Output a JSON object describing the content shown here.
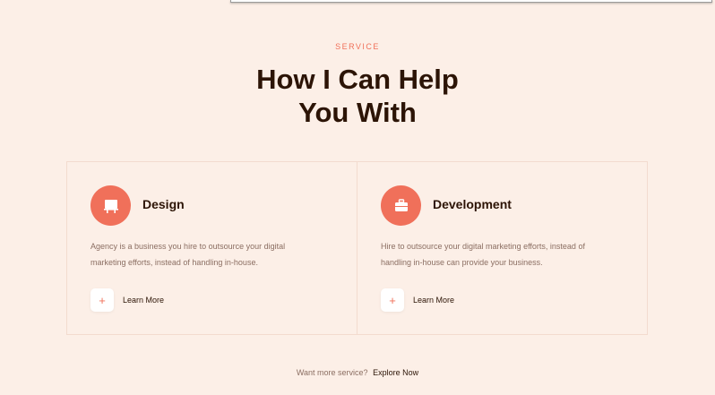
{
  "section": {
    "eyebrow": "SERVICE",
    "heading_line1": "How I Can Help",
    "heading_line2": "You With"
  },
  "services": [
    {
      "icon": "easel-icon",
      "title": "Design",
      "description_line1": "Agency is a business you hire to outsource your digital",
      "description_line2": "marketing efforts, instead of handling in-house.",
      "button_label": "Learn More"
    },
    {
      "icon": "briefcase-icon",
      "title": "Development",
      "description_line1": "Hire to outsource your digital marketing efforts, instead of",
      "description_line2": "handling in-house can provide your business.",
      "button_label": "Learn More"
    }
  ],
  "footer": {
    "text": "Want more service?",
    "link": "Explore Now"
  },
  "colors": {
    "background": "#fcefe7",
    "accent": "#f0705a",
    "heading": "#2c1406",
    "body_text": "#8b6e62"
  }
}
